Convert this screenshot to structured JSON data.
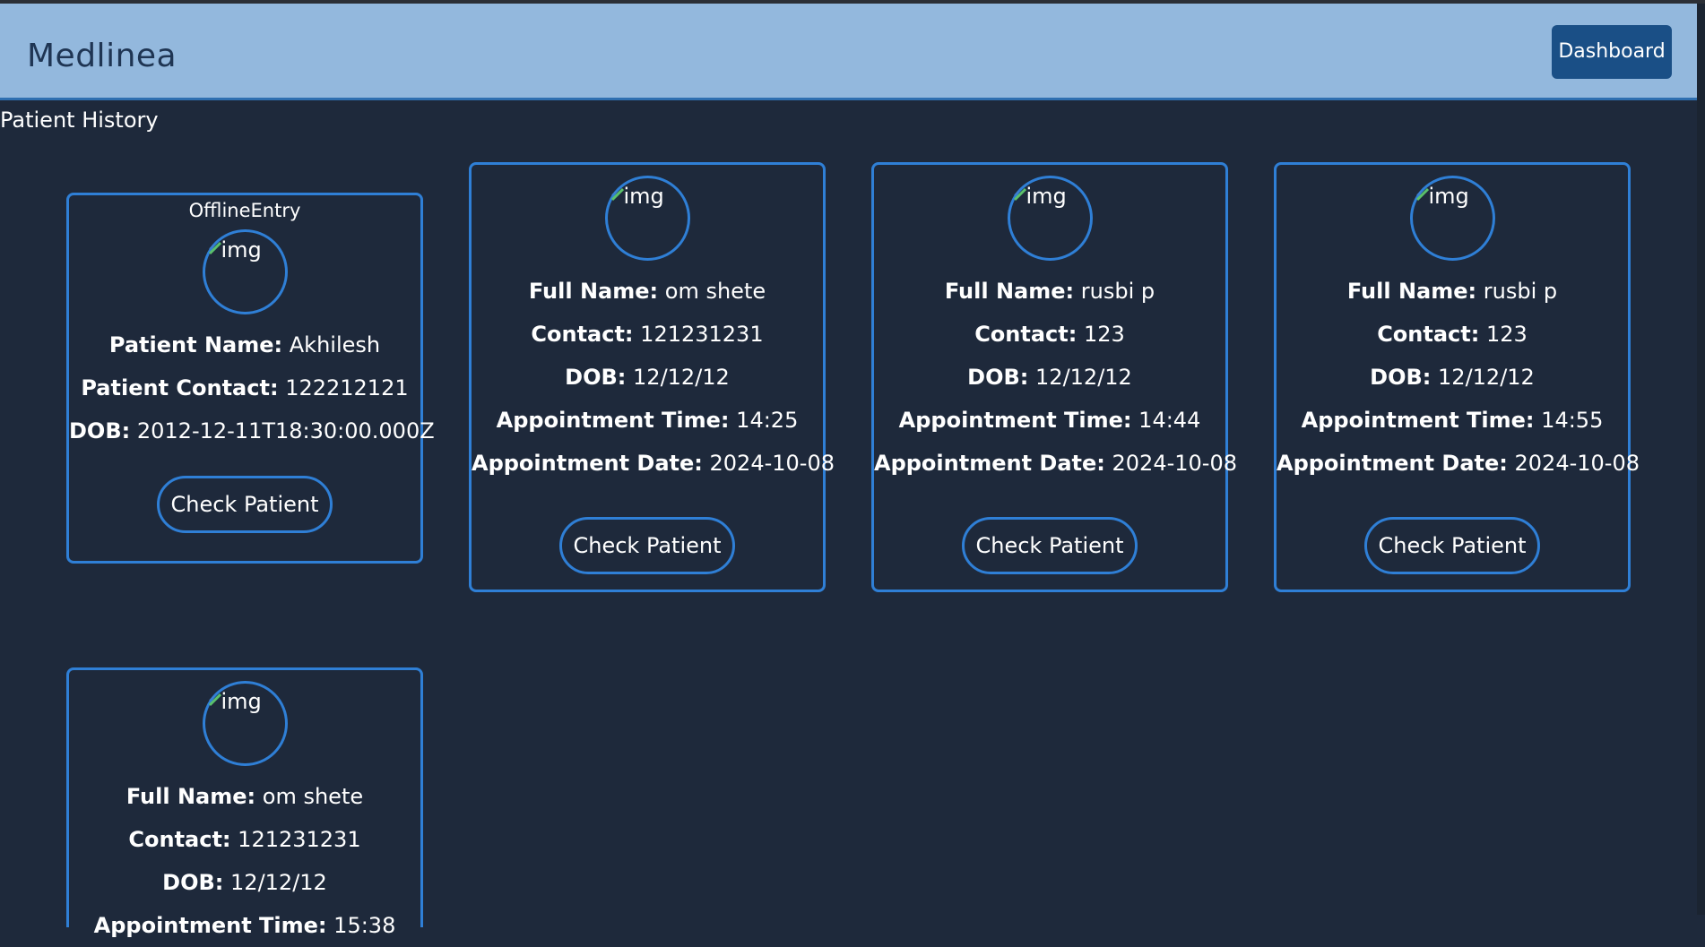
{
  "app": {
    "brand": "Medlinea",
    "dashboard_label": "Dashboard"
  },
  "page": {
    "title": "Patient History"
  },
  "avatar_alt": "img",
  "check_label": "Check Patient",
  "cards": [
    {
      "tag": "OfflineEntry",
      "fields": [
        {
          "label": "Patient Name:",
          "value": "Akhilesh"
        },
        {
          "label": "Patient Contact:",
          "value": "122212121"
        },
        {
          "label": "DOB:",
          "value": "2012-12-11T18:30:00.000Z"
        }
      ]
    },
    {
      "tag": "",
      "fields": [
        {
          "label": "Full Name:",
          "value": "om shete"
        },
        {
          "label": "Contact:",
          "value": "121231231"
        },
        {
          "label": "DOB:",
          "value": "12/12/12"
        },
        {
          "label": "Appointment Time:",
          "value": "14:25"
        },
        {
          "label": "Appointment Date:",
          "value": "2024-10-08"
        }
      ]
    },
    {
      "tag": "",
      "fields": [
        {
          "label": "Full Name:",
          "value": "rusbi p"
        },
        {
          "label": "Contact:",
          "value": "123"
        },
        {
          "label": "DOB:",
          "value": "12/12/12"
        },
        {
          "label": "Appointment Time:",
          "value": "14:44"
        },
        {
          "label": "Appointment Date:",
          "value": "2024-10-08"
        }
      ]
    },
    {
      "tag": "",
      "fields": [
        {
          "label": "Full Name:",
          "value": "rusbi p"
        },
        {
          "label": "Contact:",
          "value": "123"
        },
        {
          "label": "DOB:",
          "value": "12/12/12"
        },
        {
          "label": "Appointment Time:",
          "value": "14:55"
        },
        {
          "label": "Appointment Date:",
          "value": "2024-10-08"
        }
      ]
    },
    {
      "tag": "",
      "fields": [
        {
          "label": "Full Name:",
          "value": "om shete"
        },
        {
          "label": "Contact:",
          "value": "121231231"
        },
        {
          "label": "DOB:",
          "value": "12/12/12"
        },
        {
          "label": "Appointment Time:",
          "value": "15:38"
        }
      ]
    }
  ],
  "colors": {
    "background": "#1e293b",
    "navbar": "#93b8dd",
    "accent": "#2f7fd6",
    "button": "#1a4f86"
  }
}
